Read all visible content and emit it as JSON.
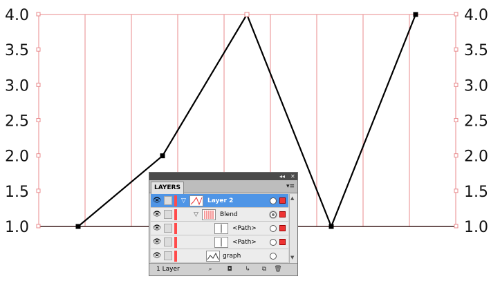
{
  "chart_data": {
    "type": "line",
    "x": [
      1,
      2,
      3,
      4,
      5
    ],
    "series": [
      {
        "values": [
          1.0,
          2.0,
          4.0,
          1.0,
          4.0
        ]
      }
    ],
    "ylim": [
      1.0,
      4.0
    ],
    "yticks": [
      "1.0",
      "1.5",
      "2.0",
      "2.5",
      "3.0",
      "3.5",
      "4.0"
    ],
    "left_axis_labels": true,
    "right_axis_labels": true,
    "vertical_guides": 9,
    "grid_color": "#e8888b",
    "line_color": "#000000",
    "title": "",
    "xlabel": "",
    "ylabel": ""
  },
  "layers_panel": {
    "tab_label": "LAYERS",
    "rows": [
      {
        "name": "Layer 2",
        "level": 0,
        "selected": true,
        "expanded": true
      },
      {
        "name": "Blend",
        "level": 1,
        "selected": false,
        "expanded": true
      },
      {
        "name": "<Path>",
        "level": 2,
        "selected": false
      },
      {
        "name": "<Path>",
        "level": 2,
        "selected": false
      },
      {
        "name": "graph",
        "level": 1,
        "selected": false
      }
    ],
    "layer_count": "1 Layer",
    "colors": {
      "selection": "#4f95e6",
      "layer_color": "#ff4b4b"
    },
    "icons": [
      "eye-icon",
      "collapse-panel-icon",
      "close-panel-icon",
      "panel-menu-icon",
      "locate-object-icon",
      "make-clipping-mask-icon",
      "new-sublayer-icon",
      "new-layer-icon",
      "delete-layer-icon"
    ]
  }
}
